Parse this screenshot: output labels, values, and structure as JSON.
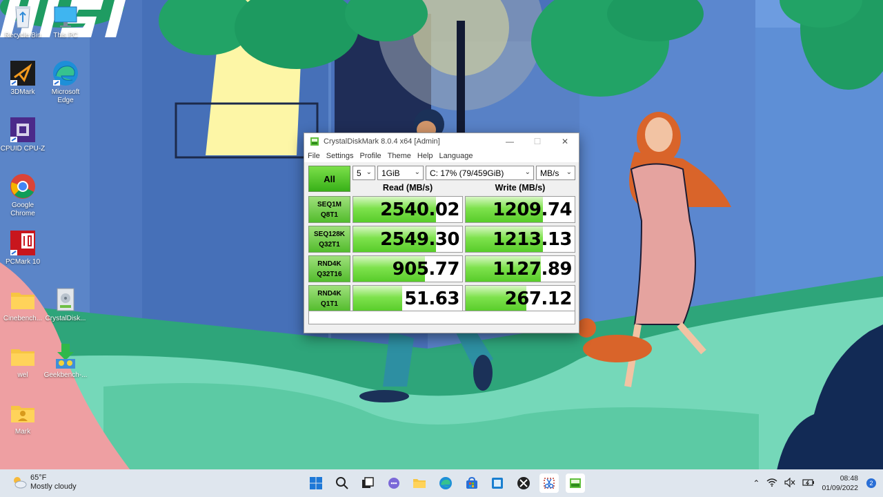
{
  "desktop": {
    "icons": [
      {
        "label": "Recycle Bin"
      },
      {
        "label": "This PC"
      },
      {
        "label": "3DMark"
      },
      {
        "label": "Microsoft Edge"
      },
      {
        "label": "CPUID CPU-Z"
      },
      {
        "label": "Google Chrome"
      },
      {
        "label": "PCMark 10"
      },
      {
        "label": "Cinebench..."
      },
      {
        "label": "CrystalDisk..."
      },
      {
        "label": "wel"
      },
      {
        "label": "Geekbench-..."
      },
      {
        "label": "Mark"
      }
    ],
    "wallpaper_logo": "MSI"
  },
  "window": {
    "title": "CrystalDiskMark 8.0.4 x64 [Admin]",
    "menu": [
      "File",
      "Settings",
      "Profile",
      "Theme",
      "Help",
      "Language"
    ],
    "all_button": "All",
    "count_select": "5",
    "size_select": "1GiB",
    "drive_select": "C: 17% (79/459GiB)",
    "unit_select": "MB/s",
    "read_header": "Read (MB/s)",
    "write_header": "Write (MB/s)",
    "rows": [
      {
        "line1": "SEQ1M",
        "line2": "Q8T1",
        "read": "2540.02",
        "write": "1209.74",
        "read_level": 0.76,
        "write_level": 0.71
      },
      {
        "line1": "SEQ128K",
        "line2": "Q32T1",
        "read": "2549.30",
        "write": "1213.13",
        "read_level": 0.76,
        "write_level": 0.71
      },
      {
        "line1": "RND4K",
        "line2": "Q32T16",
        "read": "905.77",
        "write": "1127.89",
        "read_level": 0.66,
        "write_level": 0.69
      },
      {
        "line1": "RND4K",
        "line2": "Q1T1",
        "read": "51.63",
        "write": "267.12",
        "read_level": 0.45,
        "write_level": 0.56
      }
    ],
    "comment": ""
  },
  "taskbar": {
    "weather_temp": "65°F",
    "weather_desc": "Mostly cloudy",
    "apps": [
      "start",
      "search",
      "task-view",
      "chat",
      "file-explorer",
      "edge",
      "store",
      "photos",
      "xbox",
      "snipping-tool",
      "crystaldiskmark"
    ],
    "time": "08:48",
    "date": "01/09/2022",
    "notifications": "2"
  }
}
